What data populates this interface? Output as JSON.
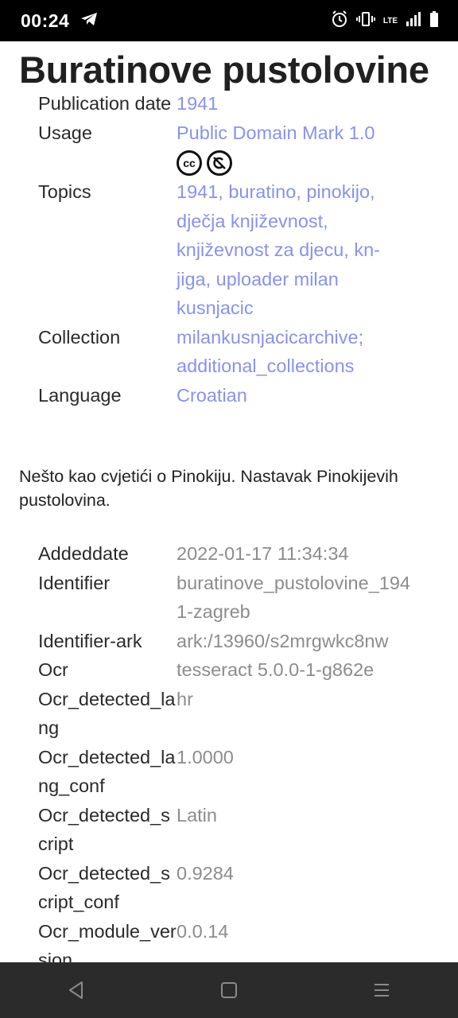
{
  "status": {
    "time": "00:24",
    "lte": "LTE"
  },
  "page": {
    "title": "Buratinove pustolovine"
  },
  "metadata": [
    {
      "key": "Publication date",
      "value": "1941",
      "link": true
    },
    {
      "key": "Usage",
      "value": "Public Domain Mark 1.0",
      "link": true,
      "cc": true
    },
    {
      "key": "Topics",
      "value": "1941, buratino, pinokijo, dječja književnost, književnost za djecu, kn-jiga, uploader milan kusnjacic",
      "link": true
    },
    {
      "key": "Collection",
      "value": "milankusnjacicarchive; additional_collections",
      "link": true
    },
    {
      "key": "Language",
      "value": "Croatian",
      "link": true
    }
  ],
  "cc_icons": [
    "cc",
    "pd"
  ],
  "description": "Nešto kao cvjetići o Pinokiju. Nastavak Pinokijevih pustolovina.",
  "details": [
    {
      "key": "Addeddate",
      "value": "2022-01-17 11:34:34"
    },
    {
      "key": "Identifier",
      "value": "buratinove_pustolovine_1941-zagreb"
    },
    {
      "key": "Identifier-ark",
      "value": "ark:/13960/s2mrgwkc8nw"
    },
    {
      "key": "Ocr",
      "value": "tesseract 5.0.0-1-g862e"
    },
    {
      "key": "Ocr_detected_lang",
      "value": "hr"
    },
    {
      "key": "Ocr_detected_lang_conf",
      "value": "1.0000"
    },
    {
      "key": "Ocr_detected_script",
      "value": "Latin"
    },
    {
      "key": "Ocr_detected_script_conf",
      "value": "0.9284"
    },
    {
      "key": "Ocr_module_version",
      "value": "0.0.14"
    }
  ]
}
